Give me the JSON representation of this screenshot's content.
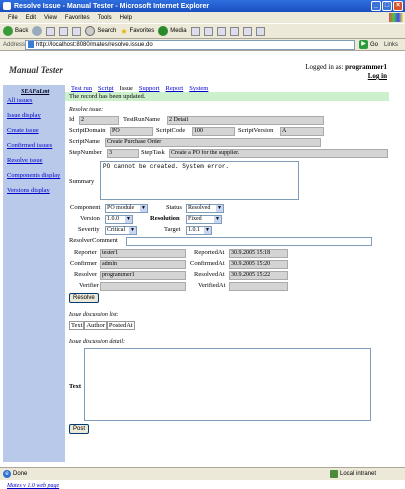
{
  "window": {
    "title": "Resolve Issue - Manual Tester - Microsoft Internet Explorer"
  },
  "menu": [
    "File",
    "Edit",
    "View",
    "Favorites",
    "Tools",
    "Help"
  ],
  "toolbar": {
    "back": "Back",
    "search": "Search",
    "favorites": "Favorites",
    "media": "Media"
  },
  "address": {
    "label": "Address",
    "url": "http://localhost:8080/mates/resolve.issue.do",
    "go": "Go",
    "links": "Links"
  },
  "header": {
    "app_title": "Manual Tester",
    "logged_in_label": "Logged in as:",
    "user": "programmer1",
    "logout": "Log in"
  },
  "sidebar": {
    "project": "SEAFaLmt",
    "items": [
      "All issues",
      "Issue display",
      "Create issue",
      "Confirmed issues",
      "Resolve issue",
      "Components display",
      "Versions display"
    ],
    "footer": "Mates v 1.0 web page"
  },
  "tabs": [
    "Test run",
    "Script",
    "Issue",
    "Support",
    "Report",
    "System"
  ],
  "message": "The record has been updated.",
  "resolve": {
    "section_title": "Resolve issue:",
    "id_label": "Id",
    "id": "2",
    "test_run_name_label": "TestRunName",
    "test_run_name": "2 Detail",
    "script_domain_label": "ScriptDomain",
    "script_domain": "PO",
    "script_code_label": "ScriptCode",
    "script_code": "100",
    "script_version_label": "ScriptVersion",
    "script_version": "A",
    "script_name_label": "ScriptName",
    "script_name": "Create Purchase Order",
    "step_number_label": "StepNumber",
    "step_number": "3",
    "step_task_label": "StepTask",
    "step_task": "Create a PO for the supplier.",
    "summary_label": "Summary",
    "summary": "PO cannot be created. System error.",
    "component_label": "Component",
    "component": "PO module",
    "status_label": "Status",
    "status": "Resolved",
    "version_label": "Version",
    "version": "1.0.0",
    "resolution_label": "Resolution",
    "resolution": "Fixed",
    "severity_label": "Severity",
    "severity": "Critical",
    "target_label": "Target",
    "target": "1.0.1",
    "resolver_comment_label": "ResolverComment",
    "resolver_comment": "",
    "reporter_label": "Reporter",
    "reporter": "tester1",
    "reported_at_label": "ReportedAt",
    "reported_at": "30.9.2005 15:18",
    "confirmer_label": "Confirmer",
    "confirmer": "admin",
    "confirmed_at_label": "ConfirmedAt",
    "confirmed_at": "30.9.2005 15:20",
    "resolver_label": "Resolver",
    "resolver": "programmer1",
    "resolved_at_label": "ResolvedAt",
    "resolved_at": "30.9.2005 15:22",
    "verifier_label": "Verifier",
    "verifier": "",
    "verified_at_label": "VerifiedAt",
    "verified_at": "",
    "resolve_button": "Resolve"
  },
  "discussion_list": {
    "title": "Issue discussion list:",
    "columns": [
      "Text",
      "Author",
      "PostedAt"
    ]
  },
  "discussion_detail": {
    "title": "Issue discussion detail:",
    "text_label": "Text",
    "post_button": "Post"
  },
  "status": {
    "left": "Done",
    "zone": "Local intranet"
  }
}
